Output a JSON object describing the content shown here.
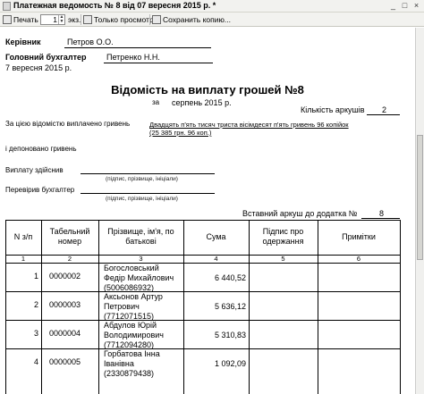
{
  "window": {
    "title": "Платежная ведомость № 8 від 07 вересня 2015 р. *",
    "minimize": "_",
    "maximize": "□",
    "close": "×"
  },
  "toolbar": {
    "print_label": "Печать",
    "copies_value": "1",
    "copies_unit": "экз.",
    "view_only_label": "Только просмотр",
    "save_copy_label": "Сохранить копию..."
  },
  "doc": {
    "head_label": "Керівник",
    "head_name": "Петров О.О.",
    "accountant_label": "Головний бухгалтер",
    "accountant_name": "Петренко Н.Н.",
    "date": "7 вересня 2015 р.",
    "title": "Відомість на виплату грошей №8",
    "period_prefix": "за",
    "period": "серпень 2015 р.",
    "sheets_label": "Кількість аркушів",
    "sheets_value": "2",
    "paid_label": "За цією відомістю виплачено гривень",
    "paid_words": "Двадцять п'ять тисяч триста вісімдесят п'ять гривень 96 копійок",
    "paid_numbers": "(25 385 грн. 96 коп.)",
    "deposited_label": "і депоновано гривень",
    "payer_label": "Виплату здійснив",
    "payer_hint": "(підпис, прізвище, ініціали)",
    "checker_label": "Перевірив бухгалтер",
    "checker_hint": "(підпис, прізвище, ініціали)",
    "inserted_label": "Вставний аркуш до додатка №",
    "inserted_value": "8"
  },
  "table": {
    "headers": [
      "N з/п",
      "Табельний номер",
      "Прізвище, ім'я, по батькові",
      "Сума",
      "Підпис про одержання",
      "Примітки"
    ],
    "col_numbers": [
      "1",
      "2",
      "3",
      "4",
      "5",
      "6"
    ],
    "rows": [
      {
        "n": "1",
        "tab": "0000002",
        "name1": "Богословський",
        "name2": "Федір Михайлович",
        "ipn": "(5006086932)",
        "sum": "6 440,52"
      },
      {
        "n": "2",
        "tab": "0000003",
        "name1": "Аксьонов Артур",
        "name2": "Петрович",
        "ipn": "(7712071515)",
        "sum": "5 636,12"
      },
      {
        "n": "3",
        "tab": "0000004",
        "name1": "Абдулов Юрій",
        "name2": "Володимирович",
        "ipn": "(7712094280)",
        "sum": "5 310,83"
      },
      {
        "n": "4",
        "tab": "0000005",
        "name1": "Горбатова Інна",
        "name2": "Іванівна",
        "ipn": "(2330879438)",
        "sum": "1 092,09"
      }
    ]
  }
}
